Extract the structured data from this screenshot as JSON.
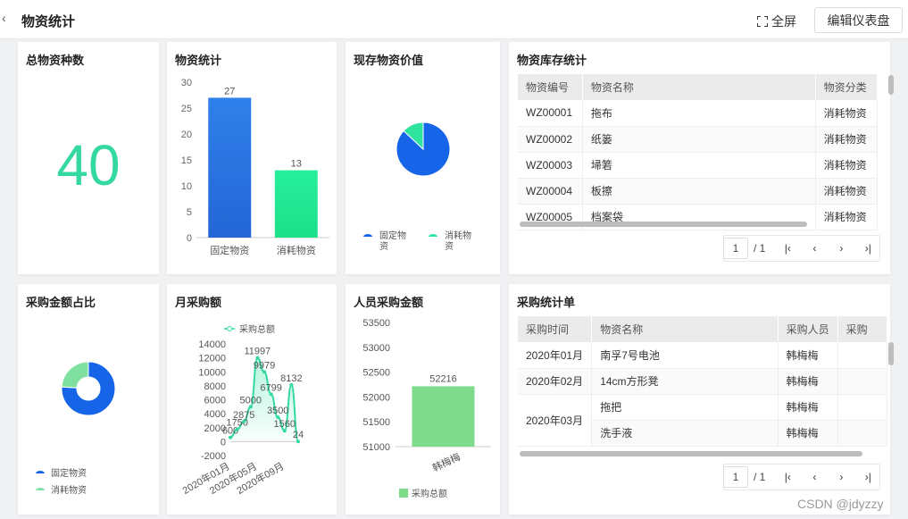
{
  "header": {
    "back_icon": "chevron-left-icon",
    "title": "物资统计",
    "fullscreen_label": "全屏",
    "edit_label": "编辑仪表盘"
  },
  "colors": {
    "blue": "#1665e8",
    "green": "#2ee39d",
    "light_green": "#7ddb8b",
    "teal": "#33d9a0"
  },
  "card_total": {
    "title": "总物资种数",
    "value": "40"
  },
  "card_bar": {
    "title": "物资统计",
    "chart_data": {
      "type": "bar",
      "categories": [
        "固定物资",
        "消耗物资"
      ],
      "values": [
        27,
        13
      ],
      "ylim": [
        0,
        30
      ],
      "yticks": [
        0,
        5,
        10,
        15,
        20,
        25,
        30
      ],
      "title": "",
      "xlabel": "",
      "ylabel": ""
    }
  },
  "card_pie": {
    "title": "现存物资价值",
    "legend": [
      "固定物",
      "资",
      "消耗物",
      "资"
    ],
    "chart_data": {
      "type": "pie",
      "categories": [
        "固定物资",
        "消耗物资"
      ],
      "values": [
        87,
        13
      ]
    }
  },
  "card_inventory": {
    "title": "物资库存统计",
    "columns": [
      "物资编号",
      "物资名称",
      "物资分类"
    ],
    "rows": [
      [
        "WZ00001",
        "拖布",
        "消耗物资"
      ],
      [
        "WZ00002",
        "纸篓",
        "消耗物资"
      ],
      [
        "WZ00003",
        "埽箬",
        "消耗物资"
      ],
      [
        "WZ00004",
        "板擦",
        "消耗物资"
      ],
      [
        "WZ00005",
        "档案袋",
        "消耗物资"
      ]
    ],
    "pager": {
      "page": "1",
      "total": "/ 1"
    }
  },
  "card_donut": {
    "title": "采购金额占比",
    "legend": [
      "固定物资",
      "消耗物资"
    ],
    "chart_data": {
      "type": "pie",
      "categories": [
        "固定物资",
        "消耗物资"
      ],
      "values": [
        76,
        24
      ]
    }
  },
  "card_line": {
    "title": "月采购额",
    "legend": "采购总额",
    "chart_data": {
      "type": "line",
      "x": [
        "2020年01月",
        "2020年02月",
        "2020年03月",
        "2020年04月",
        "2020年05月",
        "2020年06月",
        "2020年07月",
        "2020年08月",
        "2020年09月",
        "2020年10月",
        "2020年11月"
      ],
      "xticks": [
        "2020年01月",
        "2020年05月",
        "2020年09月"
      ],
      "series": [
        {
          "name": "采购总额",
          "values": [
            600,
            1750,
            2875,
            5000,
            11997,
            9979,
            6799,
            3500,
            1560,
            8132,
            24
          ]
        }
      ],
      "ylim": [
        -2000,
        14000
      ],
      "yticks": [
        -2000,
        0,
        2000,
        4000,
        6000,
        8000,
        10000,
        12000,
        14000
      ]
    }
  },
  "card_person": {
    "title": "人员采购金额",
    "legend": "采购总额",
    "chart_data": {
      "type": "bar",
      "categories": [
        "韩梅梅"
      ],
      "values": [
        52216
      ],
      "ylim": [
        51000,
        53500
      ],
      "yticks": [
        51000,
        51500,
        52000,
        52500,
        53000,
        53500
      ]
    }
  },
  "card_purchase": {
    "title": "采购统计单",
    "columns": [
      "采购时间",
      "物资名称",
      "采购人员",
      "采购"
    ],
    "rows": [
      {
        "time": "2020年01月",
        "name": "南孚7号电池",
        "person": "韩梅梅"
      },
      {
        "time": "2020年02月",
        "name": "14cm方形凳",
        "person": "韩梅梅"
      },
      {
        "time": "2020年03月",
        "name": "拖把",
        "person": "韩梅梅"
      },
      {
        "time": "",
        "name": "洗手液",
        "person": "韩梅梅"
      }
    ],
    "pager": {
      "page": "1",
      "total": "/ 1"
    }
  },
  "pager_icons": [
    "first-page-icon",
    "prev-page-icon",
    "next-page-icon",
    "last-page-icon"
  ],
  "watermark": "CSDN @jdyzzy"
}
